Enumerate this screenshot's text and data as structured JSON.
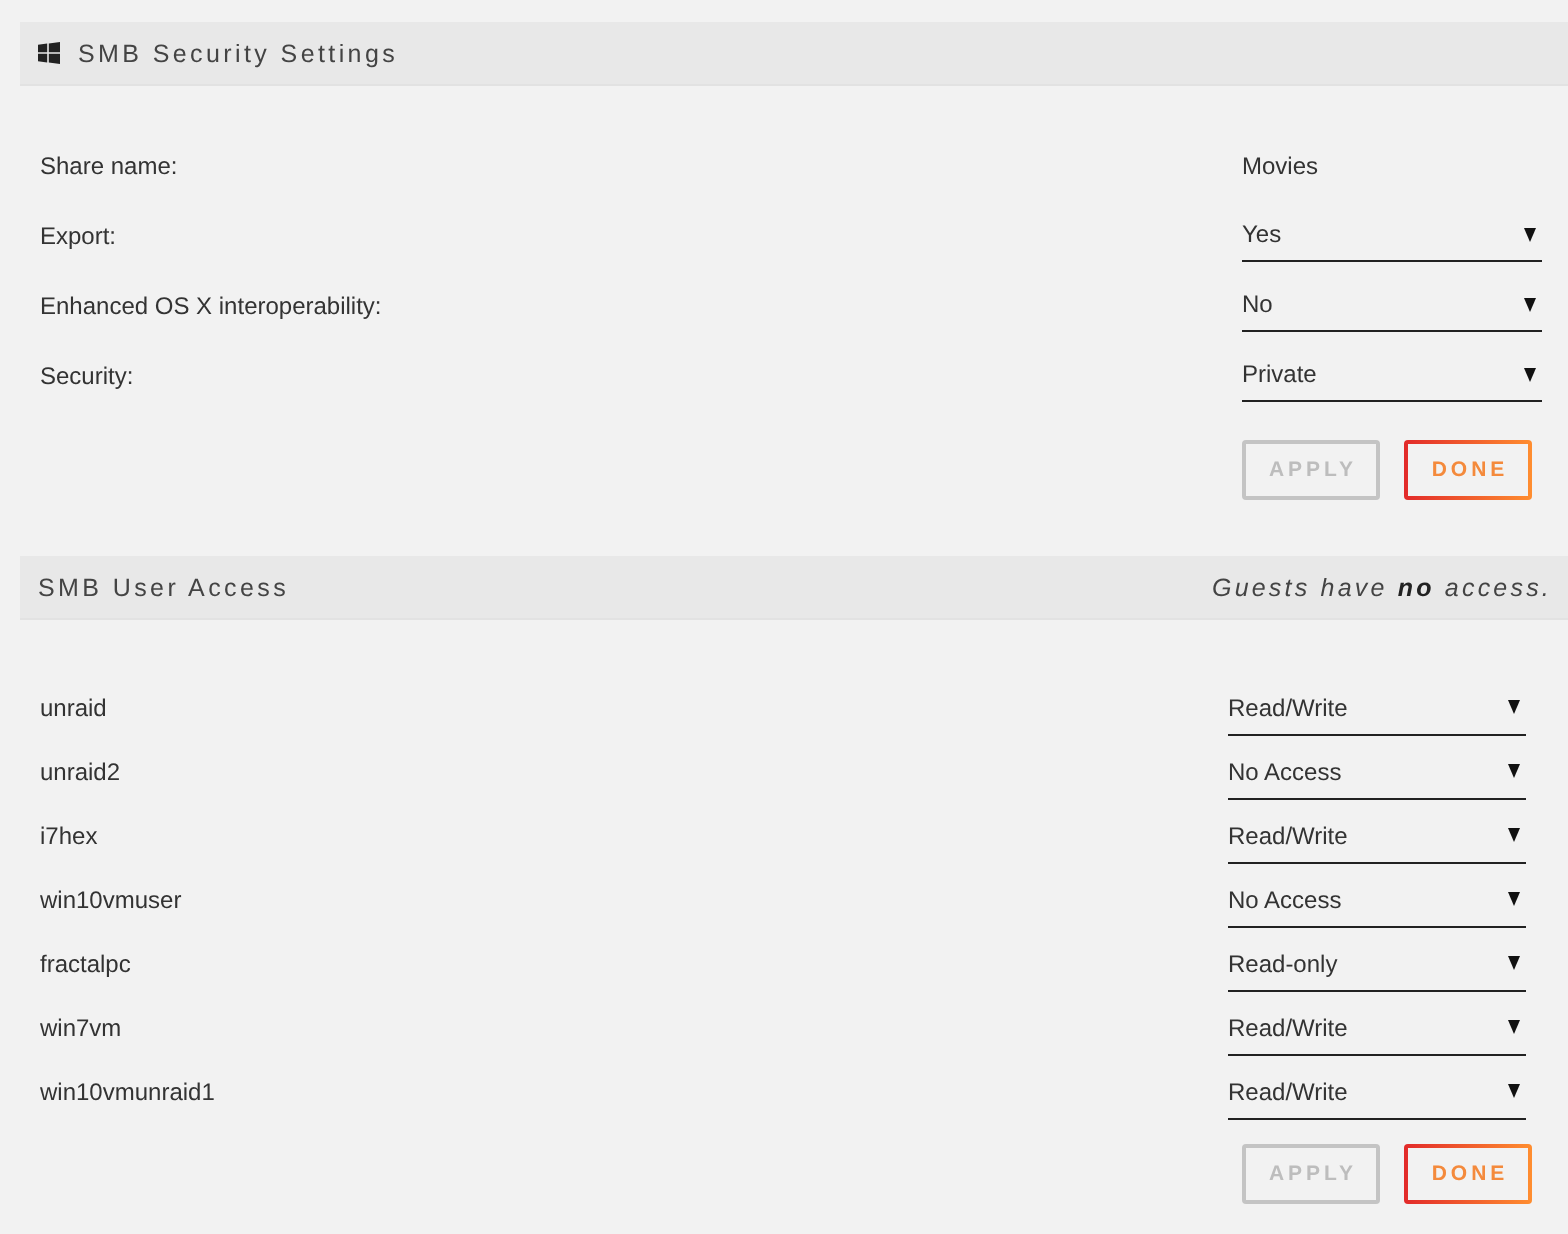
{
  "security_settings": {
    "title": "SMB Security Settings",
    "fields": [
      {
        "label": "Share name:",
        "kind": "text",
        "value": "Movies"
      },
      {
        "label": "Export:",
        "kind": "select",
        "value": "Yes"
      },
      {
        "label": "Enhanced OS X interoperability:",
        "kind": "select",
        "value": "No"
      },
      {
        "label": "Security:",
        "kind": "select",
        "value": "Private"
      }
    ],
    "buttons": [
      {
        "label": "APPLY",
        "disabled": true
      },
      {
        "label": "DONE",
        "disabled": false
      }
    ]
  },
  "user_access": {
    "title": "SMB User Access",
    "note": "Guests have **no** access.",
    "users": [
      {
        "name": "unraid",
        "access": "Read/Write"
      },
      {
        "name": "unraid2",
        "access": "No Access"
      },
      {
        "name": "i7hex",
        "access": "Read/Write"
      },
      {
        "name": "win10vmuser",
        "access": "No Access"
      },
      {
        "name": "fractalpc",
        "access": "Read-only"
      },
      {
        "name": "win7vm",
        "access": "Read/Write"
      },
      {
        "name": "win10vmunraid1",
        "access": "Read/Write"
      }
    ],
    "buttons": [
      {
        "label": "APPLY",
        "disabled": true
      },
      {
        "label": "DONE",
        "disabled": false
      }
    ]
  }
}
